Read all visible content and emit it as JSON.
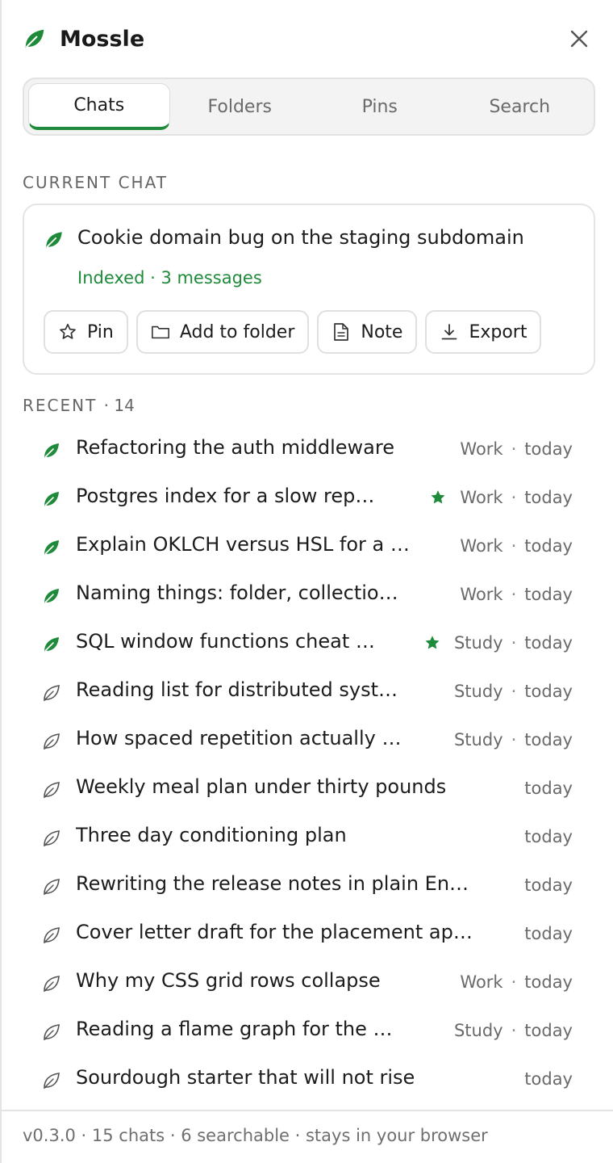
{
  "app": {
    "title": "Mossle",
    "brand_color": "#1f8b3a"
  },
  "header": {
    "logo_icon": "leaf-icon",
    "close_icon": "close-icon"
  },
  "tabs": [
    {
      "label": "Chats",
      "active": true
    },
    {
      "label": "Folders",
      "active": false
    },
    {
      "label": "Pins",
      "active": false
    },
    {
      "label": "Search",
      "active": false
    }
  ],
  "current": {
    "section_label": "CURRENT CHAT",
    "title": "Cookie domain bug on the staging subdomain",
    "status": "Indexed · 3 messages",
    "actions": [
      {
        "label": "Pin",
        "icon": "star-outline-icon"
      },
      {
        "label": "Add to folder",
        "icon": "folder-icon"
      },
      {
        "label": "Note",
        "icon": "note-icon"
      },
      {
        "label": "Export",
        "icon": "download-icon"
      }
    ]
  },
  "recent": {
    "section_label": "RECENT",
    "count": "· 14",
    "items": [
      {
        "title": "Refactoring the auth middleware",
        "folder": "Work",
        "time": "today",
        "pinned": false,
        "indexed": true
      },
      {
        "title": "Postgres index for a slow rep…",
        "folder": "Work",
        "time": "today",
        "pinned": true,
        "indexed": true
      },
      {
        "title": "Explain OKLCH versus HSL for a …",
        "folder": "Work",
        "time": "today",
        "pinned": false,
        "indexed": true
      },
      {
        "title": "Naming things: folder, collectio…",
        "folder": "Work",
        "time": "today",
        "pinned": false,
        "indexed": true
      },
      {
        "title": "SQL window functions cheat …",
        "folder": "Study",
        "time": "today",
        "pinned": true,
        "indexed": true
      },
      {
        "title": "Reading list for distributed syst…",
        "folder": "Study",
        "time": "today",
        "pinned": false,
        "indexed": false
      },
      {
        "title": "How spaced repetition actually …",
        "folder": "Study",
        "time": "today",
        "pinned": false,
        "indexed": false
      },
      {
        "title": "Weekly meal plan under thirty pounds",
        "folder": "",
        "time": "today",
        "pinned": false,
        "indexed": false
      },
      {
        "title": "Three day conditioning plan",
        "folder": "",
        "time": "today",
        "pinned": false,
        "indexed": false
      },
      {
        "title": "Rewriting the release notes in plain En…",
        "folder": "",
        "time": "today",
        "pinned": false,
        "indexed": false
      },
      {
        "title": "Cover letter draft for the placement ap…",
        "folder": "",
        "time": "today",
        "pinned": false,
        "indexed": false
      },
      {
        "title": "Why my CSS grid rows collapse",
        "folder": "Work",
        "time": "today",
        "pinned": false,
        "indexed": false
      },
      {
        "title": "Reading a flame graph for the …",
        "folder": "Study",
        "time": "today",
        "pinned": false,
        "indexed": false
      },
      {
        "title": "Sourdough starter that will not rise",
        "folder": "",
        "time": "today",
        "pinned": false,
        "indexed": false
      }
    ]
  },
  "footer": {
    "text": "v0.3.0 · 15 chats · 6 searchable · stays in your browser"
  },
  "meta_separator": "·"
}
